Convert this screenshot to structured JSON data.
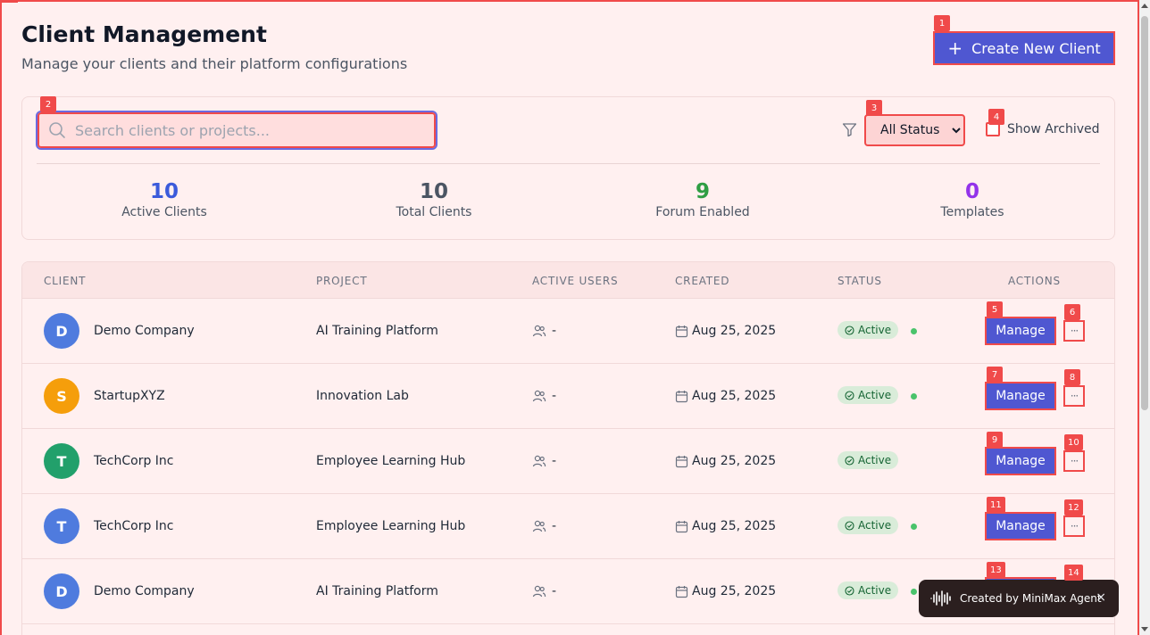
{
  "header": {
    "title": "Client Management",
    "subtitle": "Manage your clients and their platform configurations",
    "create_button_label": "Create New Client"
  },
  "filters": {
    "search_placeholder": "Search clients or projects...",
    "status_selected": "All Status",
    "show_archived_label": "Show Archived"
  },
  "stats": [
    {
      "value": "10",
      "label": "Active Clients",
      "color": "#3b5bdb"
    },
    {
      "value": "10",
      "label": "Total Clients",
      "color": "#4b5563"
    },
    {
      "value": "9",
      "label": "Forum Enabled",
      "color": "#2f9e44"
    },
    {
      "value": "0",
      "label": "Templates",
      "color": "#9333ea"
    }
  ],
  "table": {
    "columns": [
      "CLIENT",
      "PROJECT",
      "ACTIVE USERS",
      "CREATED",
      "STATUS",
      "ACTIONS"
    ],
    "rows": [
      {
        "initial": "D",
        "avatar_color": "#4f7bde",
        "client": "Demo Company",
        "project": "AI Training Platform",
        "users": "-",
        "created": "Aug 25, 2025",
        "status": "Active",
        "dot": true,
        "manage_label": "Manage"
      },
      {
        "initial": "S",
        "avatar_color": "#f59e0b",
        "client": "StartupXYZ",
        "project": "Innovation Lab",
        "users": "-",
        "created": "Aug 25, 2025",
        "status": "Active",
        "dot": true,
        "manage_label": "Manage"
      },
      {
        "initial": "T",
        "avatar_color": "#22a06b",
        "client": "TechCorp Inc",
        "project": "Employee Learning Hub",
        "users": "-",
        "created": "Aug 25, 2025",
        "status": "Active",
        "dot": false,
        "manage_label": "Manage"
      },
      {
        "initial": "T",
        "avatar_color": "#4f7bde",
        "client": "TechCorp Inc",
        "project": "Employee Learning Hub",
        "users": "-",
        "created": "Aug 25, 2025",
        "status": "Active",
        "dot": true,
        "manage_label": "Manage"
      },
      {
        "initial": "D",
        "avatar_color": "#4f7bde",
        "client": "Demo Company",
        "project": "AI Training Platform",
        "users": "-",
        "created": "Aug 25, 2025",
        "status": "Active",
        "dot": true,
        "manage_label": "Manage"
      }
    ]
  },
  "toast": {
    "text": "Created by MiniMax Agent",
    "close": "×"
  },
  "badges": [
    "1",
    "2",
    "3",
    "4",
    "5",
    "6",
    "7",
    "8",
    "9",
    "10",
    "11",
    "12",
    "13",
    "14"
  ],
  "colors": {
    "accent": "#4f57d1",
    "highlight": "#f04a4a",
    "background": "#fff0f0"
  }
}
